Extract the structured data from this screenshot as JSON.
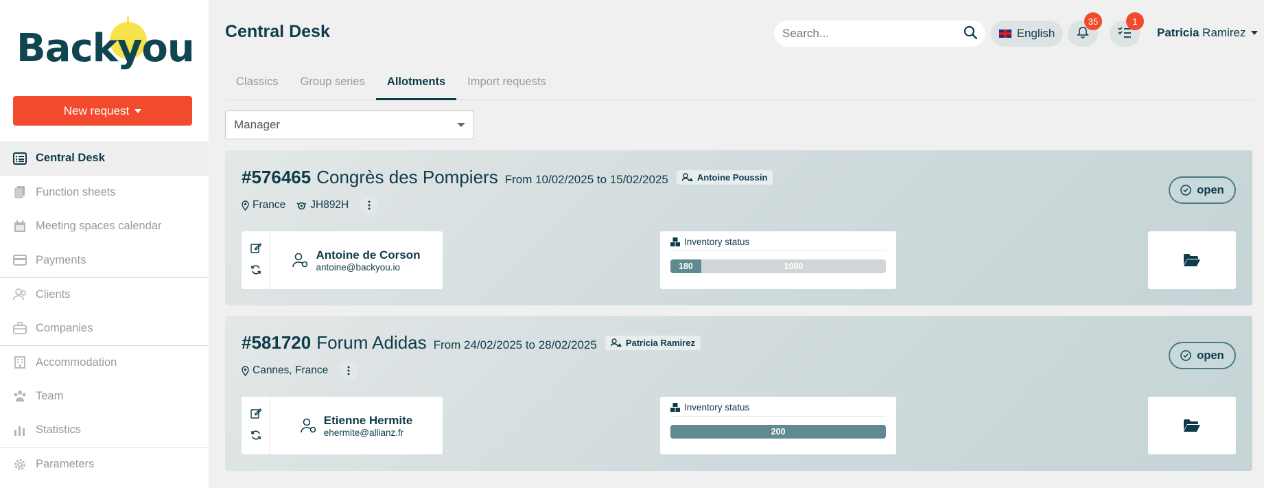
{
  "app": {
    "logo_text": "Backyou",
    "new_request_label": "New request"
  },
  "sidebar": {
    "items": [
      {
        "label": "Central Desk",
        "icon": "list-icon",
        "active": true
      },
      {
        "label": "Function sheets",
        "icon": "copy-icon"
      },
      {
        "label": "Meeting spaces calendar",
        "icon": "calendar-icon"
      },
      {
        "label": "Payments",
        "icon": "credit-card-icon"
      },
      {
        "label": "Clients",
        "icon": "users-icon"
      },
      {
        "label": "Companies",
        "icon": "briefcase-icon"
      },
      {
        "label": "Accommodation",
        "icon": "building-icon"
      },
      {
        "label": "Team",
        "icon": "team-icon"
      },
      {
        "label": "Statistics",
        "icon": "bar-chart-icon"
      },
      {
        "label": "Parameters",
        "icon": "gear-icon"
      }
    ]
  },
  "header": {
    "title": "Central Desk",
    "search_placeholder": "Search...",
    "language": "English",
    "notifications_count": "35",
    "tasks_count": "1",
    "user_first": "Patricia",
    "user_last": "Ramirez"
  },
  "tabs": [
    {
      "label": "Classics"
    },
    {
      "label": "Group series"
    },
    {
      "label": "Allotments",
      "active": true
    },
    {
      "label": "Import requests"
    }
  ],
  "filter": {
    "selected": "Manager"
  },
  "cards": [
    {
      "id": "#576465",
      "name": "Congrès des Pompiers",
      "dates": "From 10/02/2025 to 15/02/2025",
      "owner": "Antoine Poussin",
      "location": "France",
      "code": "JH892H",
      "status": "open",
      "contact_name": "Antoine de Corson",
      "contact_email": "antoine@backyou.io",
      "inventory_label": "Inventory status",
      "inventory_used": "180",
      "inventory_total": "1080",
      "inventory_fraction": 0.143
    },
    {
      "id": "#581720",
      "name": "Forum Adidas",
      "dates": "From 24/02/2025 to 28/02/2025",
      "owner": "Patricia Ramirez",
      "location": "Cannes, France",
      "status": "open",
      "contact_name": "Etienne Hermite",
      "contact_email": "ehermite@allianz.fr",
      "inventory_label": "Inventory status",
      "inventory_used": "200",
      "inventory_fraction": 1.0
    }
  ],
  "colors": {
    "accent": "#f14a2c",
    "primary": "#0e3b4a",
    "logo_sun": "#f6e24a"
  }
}
